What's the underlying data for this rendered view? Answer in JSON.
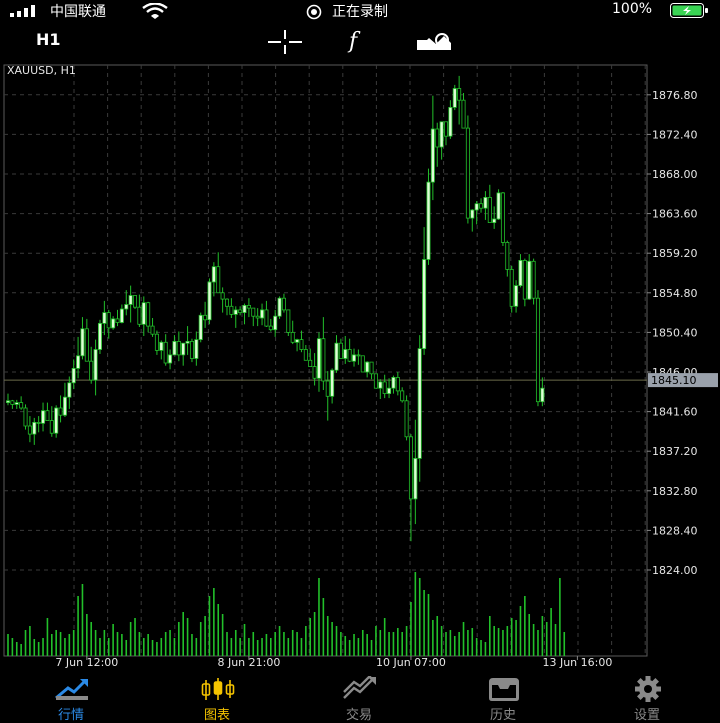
{
  "status": {
    "carrier": "中国联通",
    "recording": "正在录制",
    "battery": "100%"
  },
  "toolbar": {
    "timeframe": "H1"
  },
  "chart_data": {
    "type": "candlestick",
    "symbol_label": "XAUUSD, H1",
    "y_ticks": [
      "1876.80",
      "1872.40",
      "1868.00",
      "1863.60",
      "1859.20",
      "1854.80",
      "1850.40",
      "1846.00",
      "1841.60",
      "1837.20",
      "1832.80",
      "1828.40",
      "1824.00"
    ],
    "ylim": [
      1822.5,
      1880.5
    ],
    "current_price": 1845.1,
    "current_price_label": "1845.10",
    "x_ticks": [
      "7 Jun 12:00",
      "8 Jun 21:00",
      "10 Jun 07:00",
      "13 Jun 16:00"
    ],
    "x_tick_bar_index": [
      18,
      55,
      92,
      130
    ],
    "bull_color": "#dffcd6",
    "bear_color": "#000000",
    "wick_color": "#22c02a",
    "volume_color": "#22c02a",
    "candles": [
      [
        1842.6,
        1843.6,
        1842.3,
        1842.8
      ],
      [
        1842.8,
        1842.9,
        1841.9,
        1842.4
      ],
      [
        1842.4,
        1842.9,
        1841.9,
        1842.6
      ],
      [
        1842.6,
        1843.3,
        1841.8,
        1842.0
      ],
      [
        1842.0,
        1842.4,
        1839.6,
        1840.0
      ],
      [
        1840.0,
        1841.1,
        1838.2,
        1839.1
      ],
      [
        1839.1,
        1840.9,
        1837.9,
        1840.4
      ],
      [
        1840.4,
        1841.1,
        1839.3,
        1840.3
      ],
      [
        1840.3,
        1842.6,
        1839.4,
        1841.7
      ],
      [
        1841.7,
        1842.6,
        1840.6,
        1840.6
      ],
      [
        1840.6,
        1842.2,
        1838.8,
        1839.2
      ],
      [
        1839.2,
        1842.3,
        1838.7,
        1842.0
      ],
      [
        1842.0,
        1843.4,
        1840.4,
        1841.2
      ],
      [
        1841.2,
        1844.8,
        1841.0,
        1843.2
      ],
      [
        1843.2,
        1845.5,
        1841.9,
        1844.8
      ],
      [
        1844.8,
        1847.4,
        1844.1,
        1846.4
      ],
      [
        1846.4,
        1849.9,
        1845.3,
        1847.8
      ],
      [
        1847.8,
        1852.1,
        1847.4,
        1850.8
      ],
      [
        1850.8,
        1851.9,
        1847.3,
        1847.2
      ],
      [
        1847.2,
        1848.8,
        1844.7,
        1845.1
      ],
      [
        1845.1,
        1849.6,
        1843.4,
        1848.5
      ],
      [
        1848.5,
        1851.8,
        1848.0,
        1851.4
      ],
      [
        1851.4,
        1853.9,
        1850.1,
        1852.6
      ],
      [
        1852.6,
        1852.9,
        1849.7,
        1850.9
      ],
      [
        1850.9,
        1852.2,
        1850.7,
        1851.9
      ],
      [
        1851.9,
        1852.9,
        1851.1,
        1851.5
      ],
      [
        1851.5,
        1853.5,
        1851.4,
        1853.0
      ],
      [
        1853.0,
        1855.1,
        1852.3,
        1853.5
      ],
      [
        1853.5,
        1855.6,
        1851.5,
        1854.5
      ],
      [
        1854.5,
        1853.8,
        1853.0,
        1853.2
      ],
      [
        1853.2,
        1854.6,
        1851.0,
        1851.3
      ],
      [
        1851.3,
        1854.4,
        1850.0,
        1853.7
      ],
      [
        1853.7,
        1853.8,
        1850.4,
        1851.1
      ],
      [
        1851.1,
        1852.0,
        1849.9,
        1850.2
      ],
      [
        1850.2,
        1850.6,
        1847.9,
        1848.4
      ],
      [
        1848.4,
        1849.5,
        1847.4,
        1849.3
      ],
      [
        1849.3,
        1850.2,
        1846.7,
        1847.0
      ],
      [
        1847.0,
        1848.5,
        1846.3,
        1847.9
      ],
      [
        1847.9,
        1850.1,
        1847.9,
        1849.4
      ],
      [
        1849.4,
        1850.5,
        1847.2,
        1847.9
      ],
      [
        1847.9,
        1849.1,
        1846.7,
        1849.2
      ],
      [
        1849.2,
        1851.1,
        1847.9,
        1849.4
      ],
      [
        1849.4,
        1849.7,
        1847.1,
        1847.5
      ],
      [
        1847.5,
        1850.5,
        1846.7,
        1849.6
      ],
      [
        1849.6,
        1852.6,
        1849.3,
        1852.3
      ],
      [
        1852.3,
        1853.8,
        1850.9,
        1851.8
      ],
      [
        1851.8,
        1856.4,
        1851.3,
        1856.0
      ],
      [
        1856.0,
        1858.2,
        1854.4,
        1857.7
      ],
      [
        1857.7,
        1859.3,
        1855.3,
        1854.8
      ],
      [
        1854.8,
        1855.4,
        1852.6,
        1854.1
      ],
      [
        1854.1,
        1854.2,
        1852.3,
        1853.3
      ],
      [
        1853.3,
        1854.2,
        1852.0,
        1852.4
      ],
      [
        1852.4,
        1853.3,
        1850.9,
        1852.9
      ],
      [
        1852.9,
        1853.3,
        1852.3,
        1852.6
      ],
      [
        1852.6,
        1853.6,
        1851.3,
        1853.4
      ],
      [
        1853.4,
        1854.2,
        1852.1,
        1853.1
      ],
      [
        1853.1,
        1852.4,
        1851.1,
        1852.2
      ],
      [
        1852.2,
        1853.1,
        1851.1,
        1852.0
      ],
      [
        1852.0,
        1853.6,
        1851.2,
        1852.9
      ],
      [
        1852.9,
        1853.9,
        1851.0,
        1851.1
      ],
      [
        1851.1,
        1851.9,
        1850.5,
        1850.7
      ],
      [
        1850.7,
        1852.9,
        1849.9,
        1852.2
      ],
      [
        1852.2,
        1854.4,
        1851.9,
        1854.2
      ],
      [
        1854.2,
        1854.7,
        1852.6,
        1852.9
      ],
      [
        1852.9,
        1852.7,
        1850.0,
        1850.4
      ],
      [
        1850.4,
        1851.7,
        1849.1,
        1849.3
      ],
      [
        1849.3,
        1849.7,
        1848.3,
        1849.6
      ],
      [
        1849.6,
        1850.6,
        1848.2,
        1848.5
      ],
      [
        1848.5,
        1849.0,
        1847.5,
        1847.3
      ],
      [
        1847.3,
        1848.6,
        1846.7,
        1846.6
      ],
      [
        1846.6,
        1848.1,
        1844.5,
        1845.3
      ],
      [
        1845.3,
        1850.4,
        1843.8,
        1849.7
      ],
      [
        1849.7,
        1852.1,
        1844.0,
        1845.0
      ],
      [
        1845.0,
        1846.1,
        1840.6,
        1843.3
      ],
      [
        1843.3,
        1846.4,
        1842.5,
        1846.2
      ],
      [
        1846.2,
        1850.1,
        1845.9,
        1849.2
      ],
      [
        1849.2,
        1849.7,
        1847.5,
        1847.5
      ],
      [
        1847.5,
        1850.0,
        1846.9,
        1848.5
      ],
      [
        1848.5,
        1849.7,
        1847.1,
        1847.2
      ],
      [
        1847.2,
        1848.6,
        1846.6,
        1847.9
      ],
      [
        1847.9,
        1848.5,
        1846.8,
        1847.8
      ],
      [
        1847.8,
        1847.6,
        1846.1,
        1846.0
      ],
      [
        1846.0,
        1847.2,
        1845.4,
        1847.1
      ],
      [
        1847.1,
        1846.8,
        1845.2,
        1845.8
      ],
      [
        1845.8,
        1845.5,
        1844.7,
        1844.2
      ],
      [
        1844.2,
        1845.2,
        1843.0,
        1844.9
      ],
      [
        1844.9,
        1845.7,
        1843.1,
        1843.6
      ],
      [
        1843.6,
        1845.3,
        1843.1,
        1844.2
      ],
      [
        1844.2,
        1845.6,
        1843.6,
        1845.4
      ],
      [
        1845.4,
        1846.0,
        1843.4,
        1843.9
      ],
      [
        1843.9,
        1844.3,
        1842.6,
        1842.8
      ],
      [
        1842.8,
        1843.4,
        1838.4,
        1838.8
      ],
      [
        1838.8,
        1839.1,
        1827.2,
        1831.9
      ],
      [
        1831.9,
        1840.7,
        1829.1,
        1836.4
      ],
      [
        1836.4,
        1850.1,
        1833.8,
        1848.6
      ],
      [
        1848.6,
        1862.1,
        1847.9,
        1858.5
      ],
      [
        1858.5,
        1868.6,
        1857.9,
        1867.1
      ],
      [
        1867.1,
        1876.7,
        1865.1,
        1873.0
      ],
      [
        1873.0,
        1873.7,
        1868.8,
        1871.0
      ],
      [
        1871.0,
        1873.3,
        1869.6,
        1873.8
      ],
      [
        1873.8,
        1873.7,
        1871.2,
        1872.2
      ],
      [
        1872.2,
        1876.2,
        1871.9,
        1875.4
      ],
      [
        1875.4,
        1877.9,
        1875.1,
        1877.5
      ],
      [
        1877.5,
        1878.9,
        1873.5,
        1876.2
      ],
      [
        1876.2,
        1877.0,
        1873.1,
        1873.1
      ],
      [
        1873.1,
        1874.5,
        1862.5,
        1863.1
      ],
      [
        1863.1,
        1864.1,
        1861.6,
        1864.0
      ],
      [
        1864.0,
        1865.0,
        1862.4,
        1864.7
      ],
      [
        1864.7,
        1865.3,
        1863.7,
        1864.2
      ],
      [
        1864.2,
        1866.1,
        1862.9,
        1865.4
      ],
      [
        1865.4,
        1866.8,
        1863.5,
        1862.6
      ],
      [
        1862.6,
        1864.4,
        1861.9,
        1863.0
      ],
      [
        1863.0,
        1866.3,
        1862.9,
        1865.9
      ],
      [
        1865.9,
        1866.0,
        1860.0,
        1860.4
      ],
      [
        1860.4,
        1860.6,
        1856.6,
        1857.4
      ],
      [
        1857.4,
        1857.8,
        1852.6,
        1853.3
      ],
      [
        1853.3,
        1856.2,
        1852.6,
        1855.6
      ],
      [
        1855.6,
        1859.1,
        1855.4,
        1858.4
      ],
      [
        1858.4,
        1858.6,
        1853.3,
        1854.1
      ],
      [
        1854.1,
        1859.1,
        1854.0,
        1858.3
      ],
      [
        1858.3,
        1858.6,
        1853.5,
        1854.2
      ],
      [
        1854.2,
        1855.1,
        1842.2,
        1842.7
      ],
      [
        1842.7,
        1845.4,
        1842.2,
        1844.2
      ]
    ],
    "volumes": [
      22,
      18,
      14,
      12,
      26,
      30,
      17,
      14,
      18,
      38,
      22,
      26,
      24,
      18,
      22,
      26,
      60,
      72,
      42,
      34,
      26,
      18,
      26,
      18,
      32,
      24,
      22,
      16,
      34,
      38,
      24,
      18,
      22,
      16,
      14,
      18,
      24,
      26,
      18,
      34,
      44,
      38,
      22,
      18,
      34,
      40,
      60,
      68,
      52,
      42,
      24,
      18,
      26,
      18,
      32,
      18,
      24,
      16,
      18,
      22,
      18,
      24,
      30,
      24,
      18,
      26,
      24,
      18,
      30,
      38,
      44,
      78,
      58,
      40,
      34,
      30,
      24,
      20,
      16,
      22,
      18,
      26,
      22,
      16,
      30,
      26,
      38,
      24,
      24,
      28,
      24,
      30,
      54,
      84,
      78,
      66,
      62,
      36,
      40,
      30,
      24,
      26,
      20,
      24,
      34,
      26,
      28,
      18,
      16,
      14,
      40,
      30,
      28,
      26,
      30,
      38,
      36,
      50,
      60,
      42,
      32,
      26,
      40,
      34,
      48,
      32,
      78,
      24
    ]
  },
  "tabs": [
    {
      "label": "行情",
      "active": true
    },
    {
      "label": "图表",
      "active": false
    },
    {
      "label": "交易",
      "active": false
    },
    {
      "label": "历史",
      "active": false
    },
    {
      "label": "设置",
      "active": false
    }
  ],
  "colors": {
    "accent_blue": "#2b8ae6",
    "accent_yellow": "#f5c400",
    "grid": "#3a3a3a",
    "axis_text": "#e6e6e6",
    "battery_green": "#39d353"
  }
}
